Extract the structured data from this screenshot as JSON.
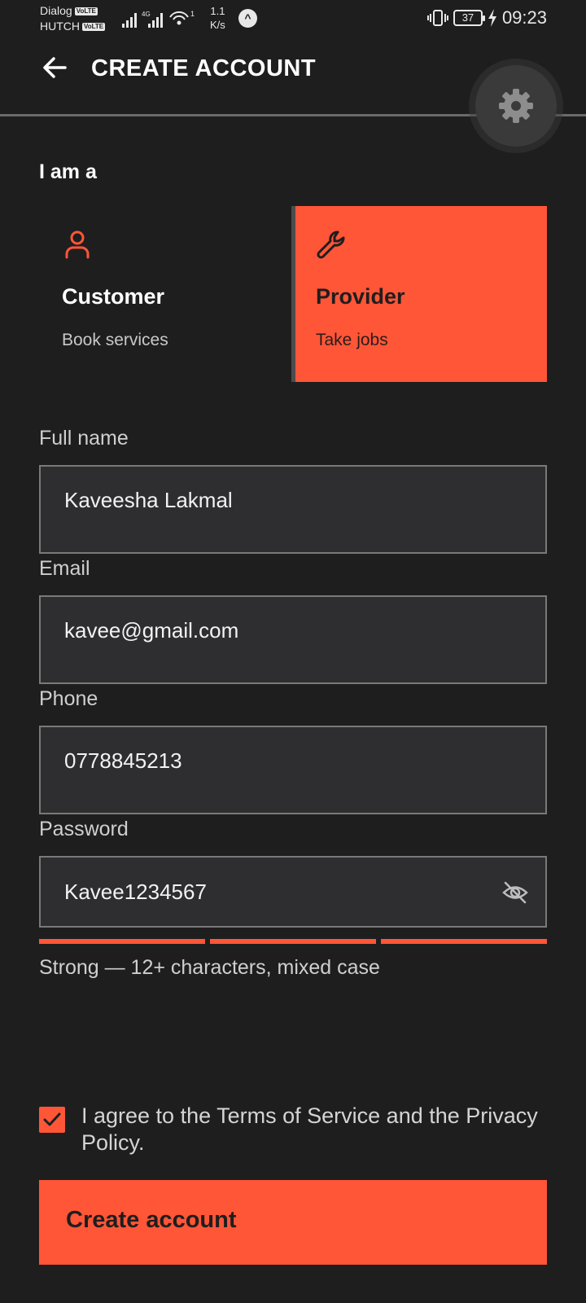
{
  "status_bar": {
    "carrier_1": "Dialog",
    "carrier_2": "HUTCH",
    "volte_badge": "VoLTE",
    "network": "4G",
    "hotspot_count": "1",
    "speed_value": "1.1",
    "speed_unit": "K/s",
    "app_indicator": "^",
    "battery": "37",
    "time": "09:23"
  },
  "header": {
    "title": "CREATE ACCOUNT",
    "back_icon": "arrow-left-icon",
    "settings_icon": "gear-icon"
  },
  "role": {
    "heading": "I am a",
    "options": [
      {
        "title": "Customer",
        "subtitle": "Book services",
        "icon": "person-icon",
        "selected": false
      },
      {
        "title": "Provider",
        "subtitle": "Take jobs",
        "icon": "wrench-icon",
        "selected": true
      }
    ]
  },
  "form": {
    "full_name": {
      "label": "Full name",
      "value": "Kaveesha Lakmal"
    },
    "email": {
      "label": "Email",
      "value": "kavee@gmail.com"
    },
    "phone": {
      "label": "Phone",
      "value": "0778845213"
    },
    "password": {
      "label": "Password",
      "value": "Kavee1234567",
      "toggle_icon": "eye-off-icon"
    },
    "password_strength": {
      "filled_segments": 3,
      "total_segments": 3,
      "text": "Strong — 12+ characters, mixed case"
    }
  },
  "terms": {
    "checked": true,
    "text": "I agree to the Terms of Service and the Privacy Policy."
  },
  "submit": {
    "label": "Create account"
  },
  "colors": {
    "background": "#1f1e1e",
    "accent": "#ff5638",
    "field_bg": "#2e2d2f",
    "field_border": "#7a797a"
  }
}
